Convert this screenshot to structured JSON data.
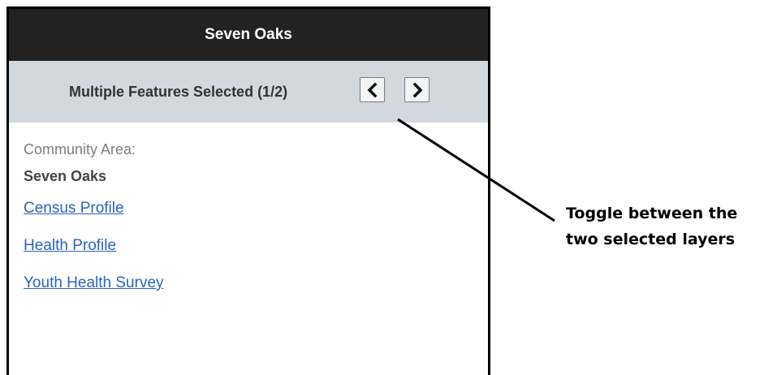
{
  "popup": {
    "title": "Seven Oaks",
    "nav": {
      "label": "Multiple Features Selected (1/2)",
      "prev_icon": "chevron-left-icon",
      "next_icon": "chevron-right-icon"
    },
    "field": {
      "label": "Community Area:",
      "value": "Seven Oaks"
    },
    "links": [
      "Census Profile",
      "Health Profile",
      "Youth Health Survey"
    ]
  },
  "annotation": {
    "line1": "Toggle between the",
    "line2": "two selected layers"
  },
  "colors": {
    "header_bg": "#222222",
    "nav_bg": "#d2d8dd",
    "link": "#2a63bf"
  }
}
